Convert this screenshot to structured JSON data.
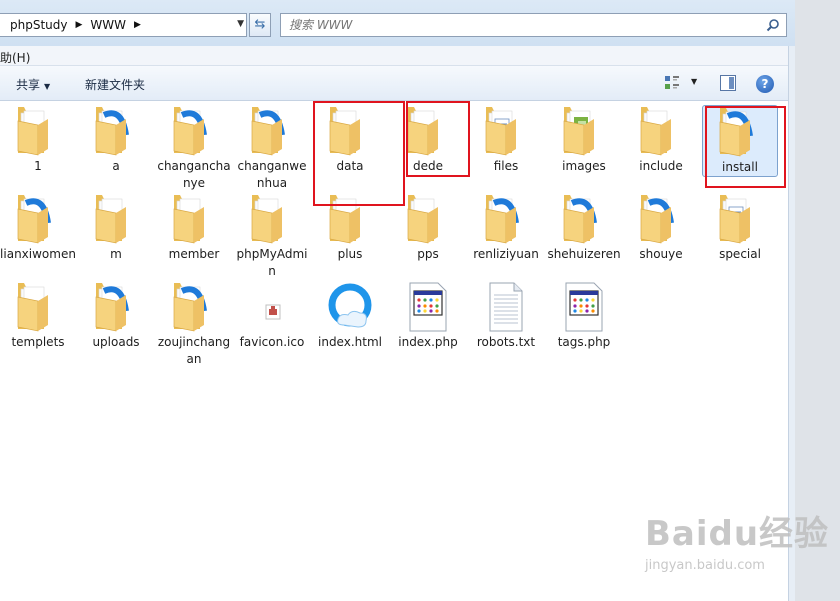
{
  "address": {
    "crumbs": [
      "phpStudy",
      "WWW"
    ],
    "search_placeholder": "搜索 WWW"
  },
  "menu": {
    "help_partial": "助(H)"
  },
  "toolbar": {
    "share": "共享",
    "new_folder": "新建文件夹"
  },
  "items": [
    {
      "label": "1",
      "icon": "folder"
    },
    {
      "label": "a",
      "icon": "folder-blue-e"
    },
    {
      "label": "changanchanye",
      "icon": "folder-blue-e"
    },
    {
      "label": "changanwenhua",
      "icon": "folder-blue-e"
    },
    {
      "label": "data",
      "icon": "folder"
    },
    {
      "label": "dede",
      "icon": "folder"
    },
    {
      "label": "files",
      "icon": "folder-doc"
    },
    {
      "label": "images",
      "icon": "folder-images"
    },
    {
      "label": "include",
      "icon": "folder"
    },
    {
      "label": "install",
      "icon": "folder-blue-e"
    },
    {
      "label": "lianxiwomen",
      "icon": "folder-blue-e"
    },
    {
      "label": "m",
      "icon": "folder"
    },
    {
      "label": "member",
      "icon": "folder"
    },
    {
      "label": "phpMyAdmin",
      "icon": "folder"
    },
    {
      "label": "plus",
      "icon": "folder"
    },
    {
      "label": "pps",
      "icon": "folder"
    },
    {
      "label": "renliziyuan",
      "icon": "folder-blue-e"
    },
    {
      "label": "shehuizeren",
      "icon": "folder-blue-e"
    },
    {
      "label": "shouye",
      "icon": "folder-blue-e"
    },
    {
      "label": "special",
      "icon": "folder-doc"
    },
    {
      "label": "templets",
      "icon": "folder"
    },
    {
      "label": "uploads",
      "icon": "folder-blue-e"
    },
    {
      "label": "zoujinchangan",
      "icon": "folder-blue-e"
    },
    {
      "label": "favicon.ico",
      "icon": "ico-file"
    },
    {
      "label": "index.html",
      "icon": "html-file"
    },
    {
      "label": "index.php",
      "icon": "php-file"
    },
    {
      "label": "robots.txt",
      "icon": "txt-file"
    },
    {
      "label": "tags.php",
      "icon": "php-file"
    }
  ],
  "watermark": {
    "brand": "Baidu经验",
    "url": "jingyan.baidu.com"
  },
  "colors": {
    "highlight": "#e0141e",
    "folder": "#f5d27a",
    "ie_blue": "#1f7ad9"
  }
}
